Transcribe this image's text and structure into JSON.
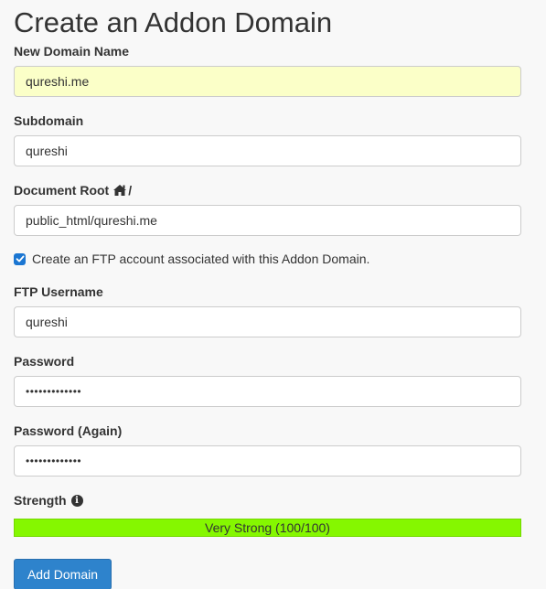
{
  "page": {
    "title": "Create an Addon Domain"
  },
  "new_domain": {
    "label": "New Domain Name",
    "value": "qureshi.me"
  },
  "subdomain": {
    "label": "Subdomain",
    "value": "qureshi"
  },
  "document_root": {
    "label": "Document Root",
    "suffix": "/",
    "icon": "home-icon",
    "value": "public_html/qureshi.me"
  },
  "ftp_checkbox": {
    "checked": true,
    "label": "Create an FTP account associated with this Addon Domain."
  },
  "ftp_username": {
    "label": "FTP Username",
    "value": "qureshi"
  },
  "password": {
    "label": "Password",
    "value": "•••••••••••••"
  },
  "password_again": {
    "label": "Password (Again)",
    "value": "•••••••••••••"
  },
  "strength": {
    "label": "Strength",
    "icon": "info-icon",
    "text": "Very Strong (100/100)",
    "percent": 100,
    "color": "#85f700"
  },
  "submit": {
    "label": "Add Domain",
    "color": "#2e83cc"
  }
}
